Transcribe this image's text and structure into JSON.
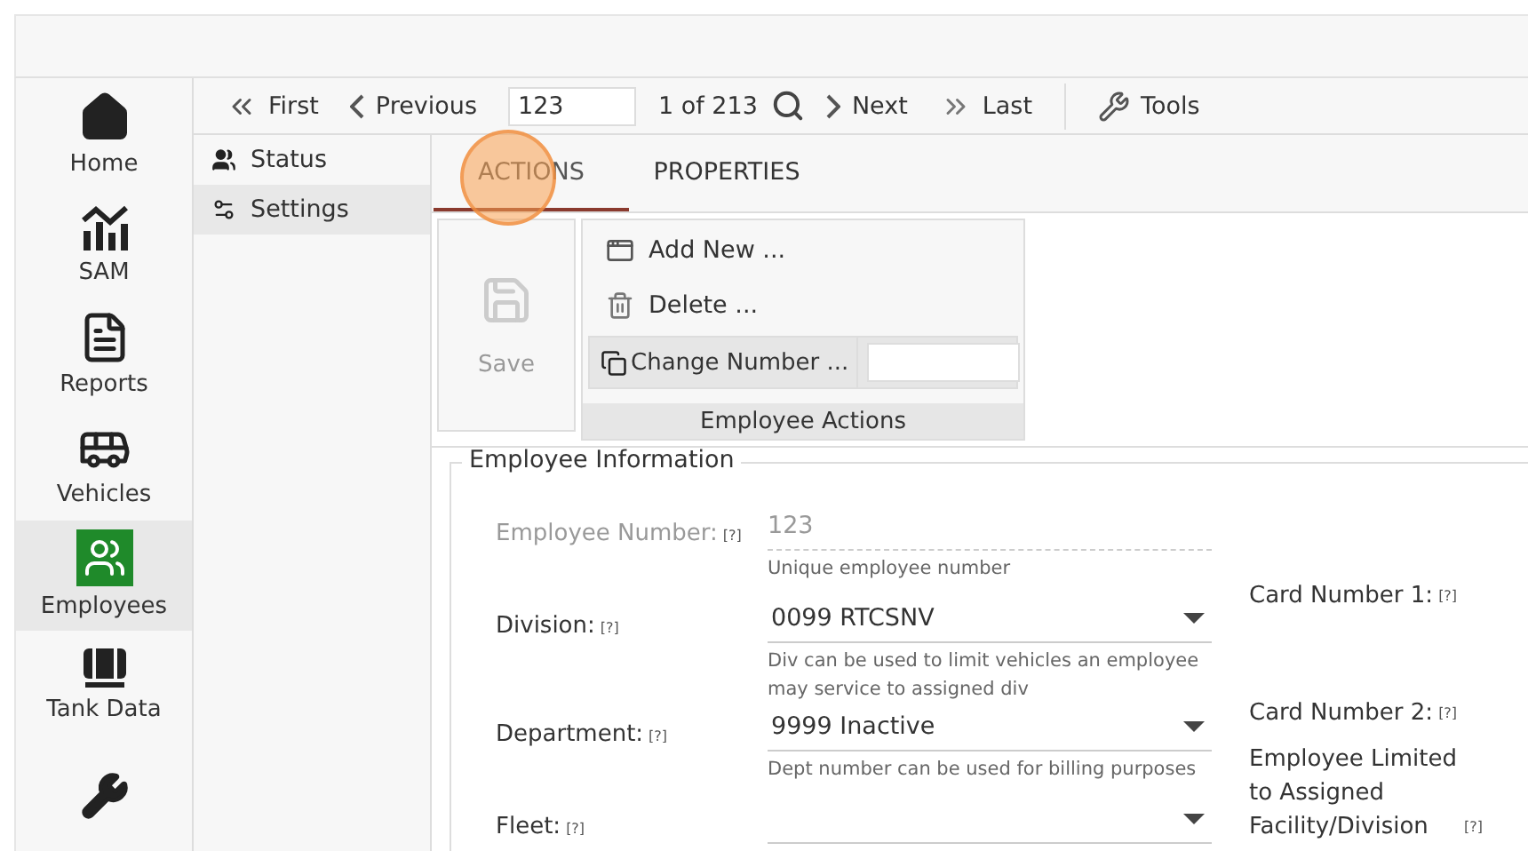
{
  "nav": [
    {
      "label": "Home",
      "selected": false
    },
    {
      "label": "SAM",
      "selected": false
    },
    {
      "label": "Reports",
      "selected": false
    },
    {
      "label": "Vehicles",
      "selected": false
    },
    {
      "label": "Employees",
      "selected": true
    },
    {
      "label": "Tank Data",
      "selected": false
    },
    {
      "selected": false
    }
  ],
  "toolbar": {
    "first": "First",
    "previous": "Previous",
    "record": "123",
    "count": "1 of 213",
    "next": "Next",
    "last": "Last",
    "tools": "Tools"
  },
  "subnav": [
    {
      "label": "Status",
      "selected": false
    },
    {
      "label": "Settings",
      "selected": true
    }
  ],
  "tabs": [
    {
      "label": "ACTIONS",
      "selected": true
    },
    {
      "label": "PROPERTIES",
      "selected": false
    }
  ],
  "actions": {
    "save": "Save",
    "save_disabled": true,
    "add_new": "Add New ...",
    "delete": "Delete ...",
    "change_number": "Change Number ...",
    "group_title": "Employee Actions"
  },
  "section": {
    "title": "Employee Information",
    "left_fields": [
      {
        "label": "Employee Number:",
        "help": "[?]",
        "value": "123",
        "hint": "Unique employee number",
        "kind": "text",
        "disabled": true
      },
      {
        "label": "Division:",
        "help": "[?]",
        "value": "0099 RTCSNV",
        "hint": "Div can be used to limit vehicles an employee may service to assigned div",
        "kind": "select",
        "disabled": false
      },
      {
        "label": "Department:",
        "help": "[?]",
        "value": "9999 Inactive",
        "hint": "Dept number can be used for billing purposes",
        "kind": "select",
        "disabled": false
      },
      {
        "label": "Fleet:",
        "help": "[?]",
        "kind": "select",
        "disabled": false
      }
    ],
    "right_fields": [
      {
        "label": "Card Number 1:",
        "help": "[?]"
      },
      {
        "label": "Card Number 2:",
        "help": "[?]"
      },
      {
        "label": "Employee Limited to Assigned Facility/Division",
        "help": "[?]"
      }
    ]
  }
}
